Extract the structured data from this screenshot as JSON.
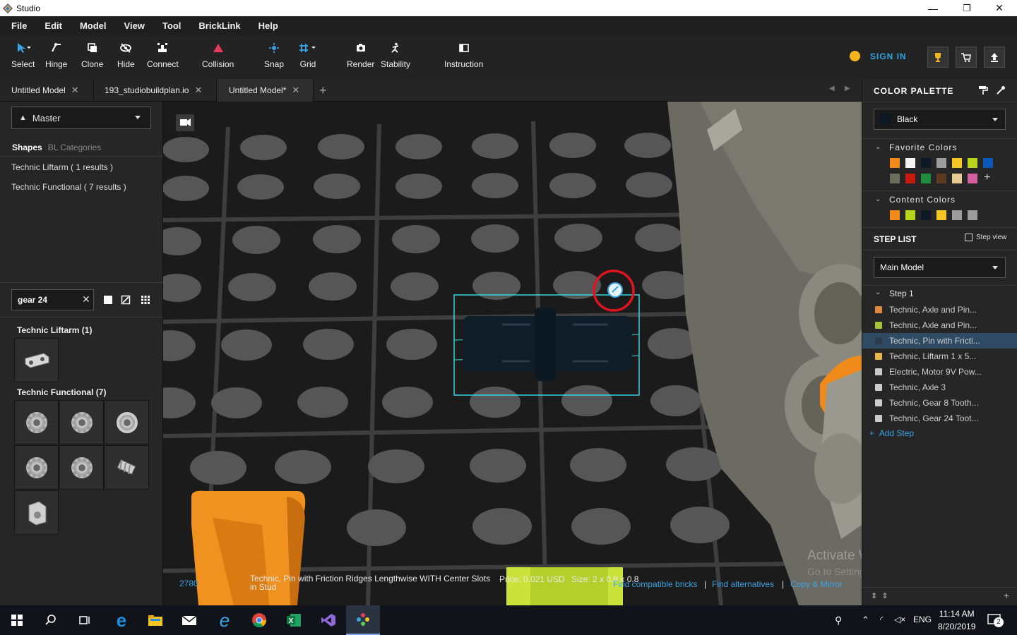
{
  "window": {
    "title": "Studio",
    "minimize": "—",
    "restore": "❐",
    "close": "✕"
  },
  "menu": [
    "File",
    "Edit",
    "Model",
    "View",
    "Tool",
    "BrickLink",
    "Help"
  ],
  "toolbar": {
    "tools": [
      {
        "label": "Select",
        "icon": "cursor-icon"
      },
      {
        "label": "Hinge",
        "icon": "hinge-icon"
      },
      {
        "label": "Clone",
        "icon": "clone-icon"
      },
      {
        "label": "Hide",
        "icon": "hide-icon"
      },
      {
        "label": "Connect",
        "icon": "connect-icon"
      },
      {
        "label": "Collision",
        "icon": "collision-icon"
      },
      {
        "label": "Snap",
        "icon": "snap-icon"
      },
      {
        "label": "Grid",
        "icon": "grid-icon"
      },
      {
        "label": "Render",
        "icon": "camera-icon"
      },
      {
        "label": "Stability",
        "icon": "stability-icon"
      },
      {
        "label": "Instruction",
        "icon": "instruction-icon"
      }
    ],
    "sign_in": "SIGN IN"
  },
  "tabs": [
    {
      "label": "Untitled Model",
      "active": false
    },
    {
      "label": "193_studiobuildplan.io",
      "active": false
    },
    {
      "label": "Untitled Model*",
      "active": true
    }
  ],
  "left": {
    "master": "Master",
    "shape_tabs": {
      "shapes": "Shapes",
      "categories": "BL Categories"
    },
    "results": [
      "Technic Liftarm ( 1 results )",
      "Technic Functional ( 7 results )"
    ],
    "search": {
      "value": "gear 24",
      "clear": "✕"
    },
    "groups": [
      {
        "title": "Technic Liftarm (1)"
      },
      {
        "title": "Technic Functional (7)"
      }
    ]
  },
  "viewport": {
    "status": {
      "id": "2780",
      "name": "Technic, Pin with Friction Ridges Lengthwise WITH Center Slots in Stud",
      "price": "Price: 0.021 USD",
      "size": "Size: 2 x 0.8 x 0.8"
    },
    "links": [
      "Find compatible bricks",
      "Find alternatives",
      "Copy & Mirror"
    ],
    "separator": "|",
    "watermark": {
      "line1": "Activate Windows",
      "line2": "Go to Settings to activate Windows."
    }
  },
  "right": {
    "color_palette_title": "COLOR PALETTE",
    "selected_color": {
      "name": "Black",
      "hex": "#0d1a26"
    },
    "favorite_title": "Favorite Colors",
    "favorite_colors": [
      "#f28a1b",
      "#f4f4f4",
      "#0d1a26",
      "#9c9c9c",
      "#f3c623",
      "#b6d51c",
      "#0a57b8",
      "#6b6e5c",
      "#c8190f",
      "#1f8c3e",
      "#5c3a22",
      "#e5cb92",
      "#d25f9e"
    ],
    "favorite_add": "+",
    "content_title": "Content Colors",
    "content_colors": [
      "#f28a1b",
      "#b6d51c",
      "#0d1a26",
      "#f3c623",
      "#9c9c9c",
      "#9c9c9c"
    ],
    "step_list_title": "STEP LIST",
    "step_view": "Step view",
    "model_select": "Main Model",
    "step_title": "Step 1",
    "steps": [
      {
        "label": "Technic, Axle and Pin...",
        "color": "#e08a3c",
        "selected": false
      },
      {
        "label": "Technic, Axle and Pin...",
        "color": "#a5c43a",
        "selected": false
      },
      {
        "label": "Technic, Pin with Fricti...",
        "color": "#2d3c4a",
        "selected": true
      },
      {
        "label": "Technic, Liftarm 1 x 5...",
        "color": "#e7b54a",
        "selected": false
      },
      {
        "label": "Electric, Motor 9V Pow...",
        "color": "#cccccc",
        "selected": false
      },
      {
        "label": "Technic, Axle 3",
        "color": "#cccccc",
        "selected": false
      },
      {
        "label": "Technic, Gear 8 Tooth...",
        "color": "#cccccc",
        "selected": false
      },
      {
        "label": "Technic, Gear 24 Toot...",
        "color": "#cccccc",
        "selected": false
      }
    ],
    "add_step": "Add Step"
  },
  "taskbar": {
    "lang": "ENG",
    "time": "11:14 AM",
    "date": "8/20/2019",
    "notifications": "2"
  }
}
